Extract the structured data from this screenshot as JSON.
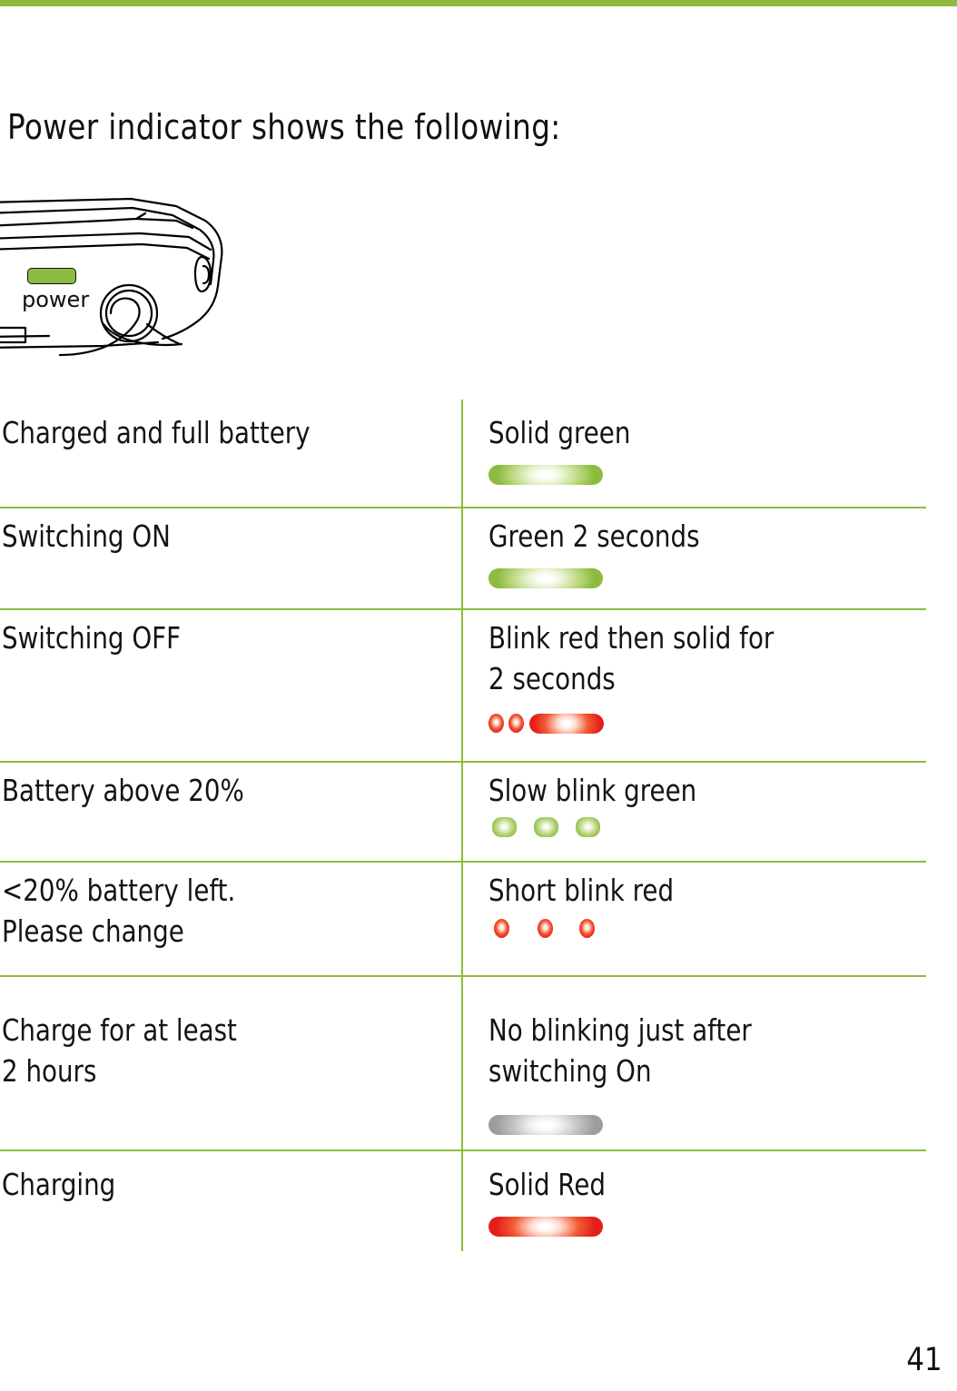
{
  "page": {
    "number": "41",
    "heading": "Power indicator shows the following:",
    "accent_green": "#8cbb3f",
    "accent_red": "#e41f18",
    "accent_gray": "#9d9d9d"
  },
  "illustration": {
    "name": "device-power-button-diagram",
    "led_label": "power",
    "led_color": "#8cbb3f"
  },
  "table": {
    "rows": [
      {
        "condition": [
          "Charged and full battery"
        ],
        "behaviour": [
          "Solid green"
        ],
        "indicator": "solid-green-pill"
      },
      {
        "condition": [
          "Switching ON"
        ],
        "behaviour": [
          "Green 2 seconds"
        ],
        "indicator": "solid-green-pill"
      },
      {
        "condition": [
          "Switching OFF"
        ],
        "behaviour": [
          "Blink red then solid for",
          "2 seconds"
        ],
        "indicator": "two-red-dots-then-red-pill"
      },
      {
        "condition": [
          "Battery above 20%"
        ],
        "behaviour": [
          "Slow blink green"
        ],
        "indicator": "three-green-ovals"
      },
      {
        "condition": [
          "<20% battery left.",
          "Please change"
        ],
        "behaviour": [
          "Short blink red"
        ],
        "indicator": "three-red-dots"
      },
      {
        "condition": [
          "Charge for at least",
          "2 hours"
        ],
        "behaviour": [
          "No blinking just after",
          "switching On"
        ],
        "indicator": "gray-pill"
      },
      {
        "condition": [
          "Charging"
        ],
        "behaviour": [
          "Solid Red"
        ],
        "indicator": "solid-red-pill"
      }
    ]
  }
}
